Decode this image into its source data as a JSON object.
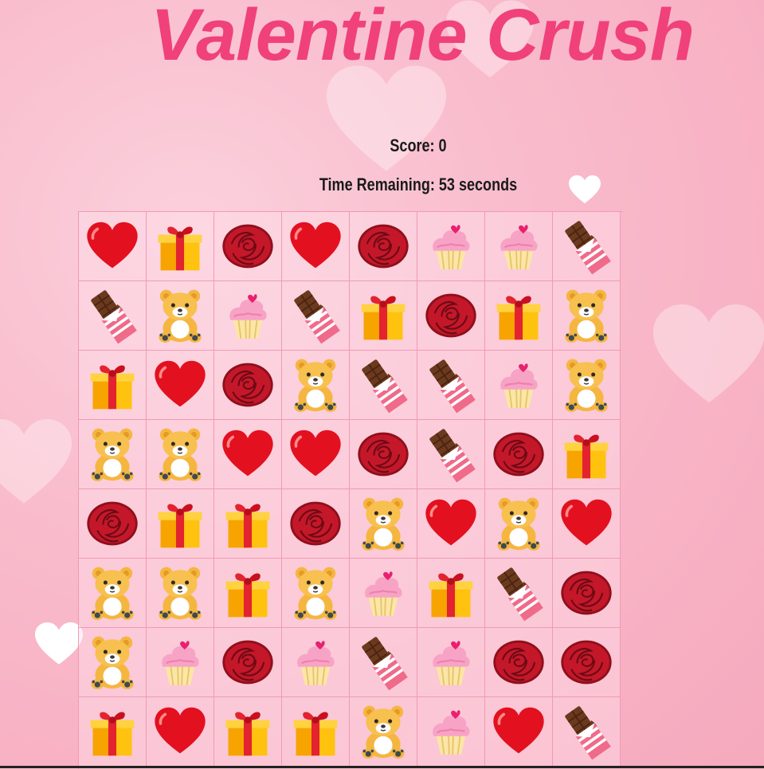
{
  "title": "Valentine Crush",
  "score_label": "Score: 0",
  "time_label": "Time Remaining: 53 seconds",
  "colors": {
    "title": "#f0417a",
    "grid_line": "#f19ab5",
    "background": "#f9bccc"
  },
  "board": [
    [
      "heart",
      "gift",
      "rose",
      "heart",
      "rose",
      "cupcake",
      "cupcake",
      "chocolate"
    ],
    [
      "chocolate",
      "bear",
      "cupcake",
      "chocolate",
      "gift",
      "rose",
      "gift",
      "bear"
    ],
    [
      "gift",
      "heart",
      "rose",
      "bear",
      "chocolate",
      "chocolate",
      "cupcake",
      "bear"
    ],
    [
      "bear",
      "bear",
      "heart",
      "heart",
      "rose",
      "chocolate",
      "rose",
      "gift"
    ],
    [
      "rose",
      "gift",
      "gift",
      "rose",
      "bear",
      "heart",
      "bear",
      "heart"
    ],
    [
      "bear",
      "bear",
      "gift",
      "bear",
      "cupcake",
      "gift",
      "chocolate",
      "rose"
    ],
    [
      "bear",
      "cupcake",
      "rose",
      "cupcake",
      "chocolate",
      "cupcake",
      "rose",
      "rose"
    ],
    [
      "gift",
      "heart",
      "gift",
      "gift",
      "bear",
      "cupcake",
      "heart",
      "chocolate"
    ]
  ]
}
